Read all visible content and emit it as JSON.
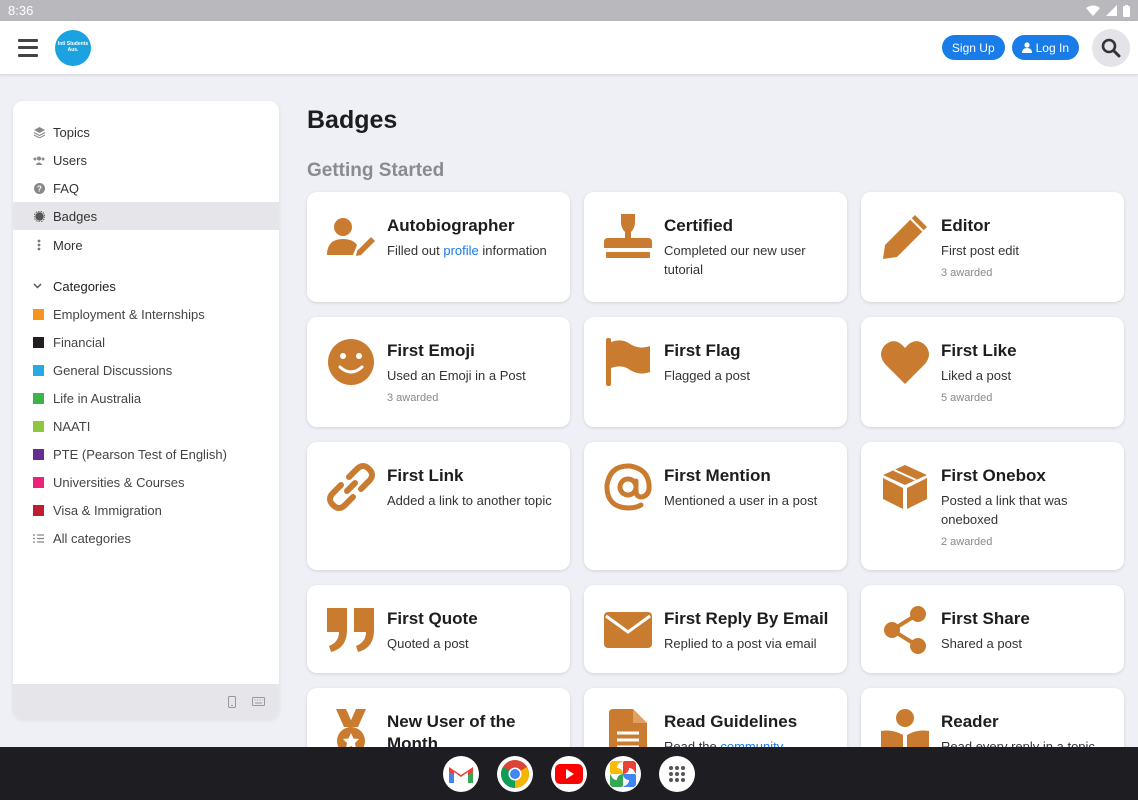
{
  "status_bar": {
    "time": "8:36"
  },
  "header": {
    "logo_text": "Intl Students Aus.",
    "signup_label": "Sign Up",
    "login_label": "Log In"
  },
  "sidebar": {
    "nav": [
      {
        "label": "Topics",
        "icon": "layers-icon"
      },
      {
        "label": "Users",
        "icon": "users-icon"
      },
      {
        "label": "FAQ",
        "icon": "question-icon"
      },
      {
        "label": "Badges",
        "icon": "badge-icon"
      },
      {
        "label": "More",
        "icon": "kebab-icon"
      }
    ],
    "categories_label": "Categories",
    "categories": [
      {
        "label": "Employment & Internships",
        "color": "#f7941d"
      },
      {
        "label": "Financial",
        "color": "#231f20"
      },
      {
        "label": "General Discussions",
        "color": "#25aae1"
      },
      {
        "label": "Life in Australia",
        "color": "#3ab54a"
      },
      {
        "label": "NAATI",
        "color": "#8dc63f"
      },
      {
        "label": "PTE (Pearson Test of English)",
        "color": "#652d90"
      },
      {
        "label": "Universities & Courses",
        "color": "#ed207b"
      },
      {
        "label": "Visa & Immigration",
        "color": "#be1e2d"
      }
    ],
    "all_categories": "All categories"
  },
  "main": {
    "title": "Badges",
    "section": "Getting Started",
    "badge_color": "#c97c2f",
    "badges": [
      {
        "name": "Autobiographer",
        "desc_pre": "Filled out ",
        "desc_link": "profile",
        "desc_post": " information",
        "awarded": "",
        "icon": "user-edit-icon"
      },
      {
        "name": "Certified",
        "desc_pre": "Completed our new user tutorial",
        "desc_link": "",
        "desc_post": "",
        "awarded": "",
        "icon": "stamp-icon"
      },
      {
        "name": "Editor",
        "desc_pre": "First post edit",
        "desc_link": "",
        "desc_post": "",
        "awarded": "3 awarded",
        "icon": "pencil-icon"
      },
      {
        "name": "First Emoji",
        "desc_pre": "Used an Emoji in a Post",
        "desc_link": "",
        "desc_post": "",
        "awarded": "3 awarded",
        "icon": "smiley-icon"
      },
      {
        "name": "First Flag",
        "desc_pre": "Flagged a post",
        "desc_link": "",
        "desc_post": "",
        "awarded": "",
        "icon": "flag-icon"
      },
      {
        "name": "First Like",
        "desc_pre": "Liked a post",
        "desc_link": "",
        "desc_post": "",
        "awarded": "5 awarded",
        "icon": "heart-icon"
      },
      {
        "name": "First Link",
        "desc_pre": "Added a link to another topic",
        "desc_link": "",
        "desc_post": "",
        "awarded": "",
        "icon": "link-icon"
      },
      {
        "name": "First Mention",
        "desc_pre": "Mentioned a user in a post",
        "desc_link": "",
        "desc_post": "",
        "awarded": "",
        "icon": "at-icon"
      },
      {
        "name": "First Onebox",
        "desc_pre": "Posted a link that was oneboxed",
        "desc_link": "",
        "desc_post": "",
        "awarded": "2 awarded",
        "icon": "cube-icon"
      },
      {
        "name": "First Quote",
        "desc_pre": "Quoted a post",
        "desc_link": "",
        "desc_post": "",
        "awarded": "",
        "icon": "quote-icon"
      },
      {
        "name": "First Reply By Email",
        "desc_pre": "Replied to a post via email",
        "desc_link": "",
        "desc_post": "",
        "awarded": "",
        "icon": "envelope-icon"
      },
      {
        "name": "First Share",
        "desc_pre": "Shared a post",
        "desc_link": "",
        "desc_post": "",
        "awarded": "",
        "icon": "share-icon"
      },
      {
        "name": "New User of the Month",
        "desc_pre": "",
        "desc_link": "",
        "desc_post": "",
        "awarded": "",
        "icon": "medal-icon"
      },
      {
        "name": "Read Guidelines",
        "desc_pre": "Read the ",
        "desc_link": "community",
        "desc_post": "",
        "awarded": "",
        "icon": "document-icon"
      },
      {
        "name": "Reader",
        "desc_pre": "Read every reply in a topic",
        "desc_link": "",
        "desc_post": "",
        "awarded": "",
        "icon": "reader-icon"
      }
    ]
  },
  "taskbar": {
    "apps": [
      "gmail-icon",
      "chrome-icon",
      "youtube-icon",
      "photos-icon",
      "app-drawer-icon"
    ]
  }
}
